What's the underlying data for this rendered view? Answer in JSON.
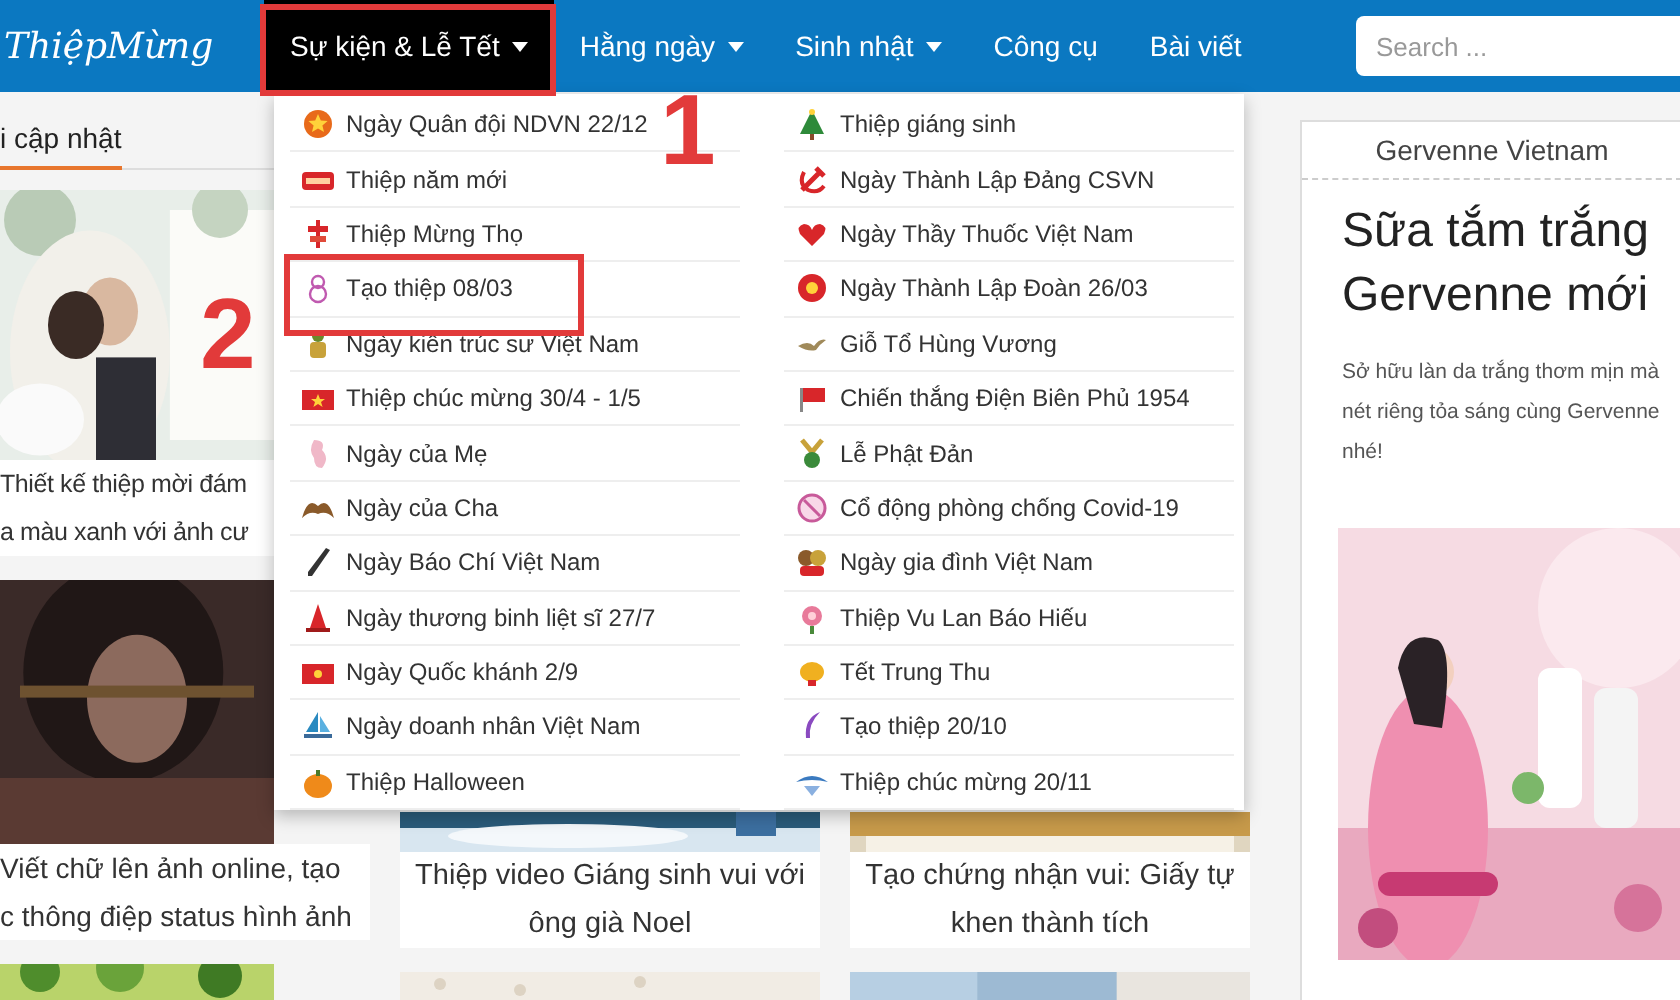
{
  "header": {
    "logo": "ThiệpMừng",
    "nav": [
      {
        "label": "Sự kiện & Lễ Tết",
        "selected": true,
        "has_menu": true
      },
      {
        "label": "Hằng ngày",
        "selected": false,
        "has_menu": true
      },
      {
        "label": "Sinh nhật",
        "selected": false,
        "has_menu": true
      },
      {
        "label": "Công cụ",
        "selected": false,
        "has_menu": false
      },
      {
        "label": "Bài viết",
        "selected": false,
        "has_menu": false
      }
    ],
    "search": {
      "placeholder": "Search ..."
    }
  },
  "section": {
    "heading": "i cập nhật"
  },
  "card_columns": [
    [
      {
        "kind": "post",
        "title_lines": [
          "Thiết kế thiệp mời đám",
          "a màu xanh với ảnh cư"
        ]
      },
      {
        "kind": "post",
        "title_lines": [
          "Viết chữ lên ảnh online, tạo",
          "c thông điệp status hình ảnh"
        ]
      },
      {
        "kind": "picture"
      }
    ],
    [
      {
        "kind": "post",
        "title_lines": [
          "Thiệp video Giáng sinh vui với",
          "ông già Noel"
        ]
      },
      {
        "kind": "picture"
      }
    ],
    [
      {
        "kind": "post",
        "title_lines": [
          "Tạo chứng nhận vui: Giấy tự",
          "khen thành tích"
        ]
      },
      {
        "kind": "picture"
      }
    ]
  ],
  "dropdown": {
    "columns": [
      [
        "Ngày Quân đội NDVN 22/12",
        "Thiệp năm mới",
        "Thiệp Mừng Thọ",
        "Tạo thiệp 08/03",
        "Ngày kiến trúc sư Việt Nam",
        "Thiệp chúc mừng 30/4 - 1/5",
        "Ngày của Mẹ",
        "Ngày của Cha",
        "Ngày Báo Chí Việt Nam",
        "Ngày thương binh liệt sĩ 27/7",
        "Ngày Quốc khánh 2/9",
        "Ngày doanh nhân Việt Nam",
        "Thiệp Halloween"
      ],
      [
        "Thiệp giáng sinh",
        "Ngày Thành Lập Đảng CSVN",
        "Ngày Thầy Thuốc Việt Nam",
        "Ngày Thành Lập Đoàn 26/03",
        "Giỗ Tổ Hùng Vương",
        "Chiến thắng Điện Biên Phủ 1954",
        "Lễ Phật Đản",
        "Cổ động phòng chống Covid-19",
        "Ngày gia đình Việt Nam",
        "Thiệp Vu Lan Báo Hiếu",
        "Tết Trung Thu",
        "Tạo thiệp 20/10",
        "Thiệp chúc mừng 20/11"
      ]
    ]
  },
  "annotations": [
    {
      "label": "1"
    },
    {
      "label": "2"
    }
  ],
  "sidebar": {
    "title": "Gervenne Vietnam",
    "headline": "Sữa tắm trắng Gervenne mới",
    "text": "Sở hữu làn da trắng thơm mịn mà nét riêng tỏa sáng cùng Gervenne nhé!"
  }
}
